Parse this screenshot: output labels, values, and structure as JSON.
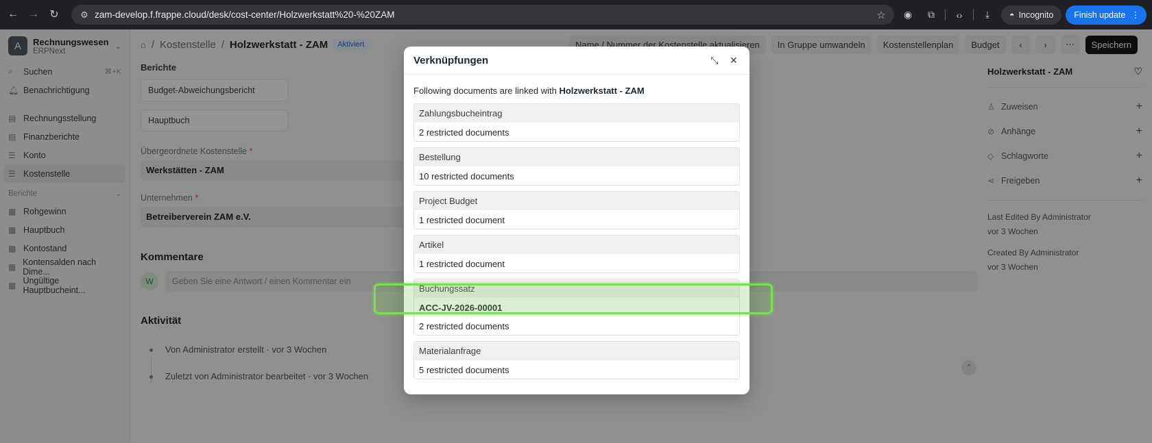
{
  "browser": {
    "url": "zam-develop.f.frappe.cloud/desk/cost-center/Holzwerkstatt%20-%20ZAM",
    "incognito_label": "Incognito",
    "update_label": "Finish update"
  },
  "sidebar": {
    "workspace_name": "Rechnungswesen",
    "workspace_app": "ERPNext",
    "workspace_initial": "A",
    "search_label": "Suchen",
    "search_shortcut": "⌘+K",
    "notification_label": "Benachrichtigung",
    "items": [
      {
        "label": "Rechnungsstellung"
      },
      {
        "label": "Finanzberichte"
      },
      {
        "label": "Konto"
      },
      {
        "label": "Kostenstelle"
      }
    ],
    "reports_section": "Berichte",
    "reports": [
      {
        "label": "Rohgewinn"
      },
      {
        "label": "Hauptbuch"
      },
      {
        "label": "Kontostand"
      },
      {
        "label": "Kontensalden nach Dime..."
      },
      {
        "label": "Ungültige Hauptbucheint..."
      }
    ]
  },
  "header": {
    "breadcrumb": "Kostenstelle",
    "title": "Holzwerkstatt - ZAM",
    "status": "Aktiviert",
    "actions": [
      "Name / Nummer der Kostenstelle aktualisieren",
      "In Gruppe umwandeln",
      "Kostenstellenplan",
      "Budget"
    ],
    "save_label": "Speichern"
  },
  "form": {
    "reports_title": "Berichte",
    "report_links": [
      "Budget-Abweichungsbericht",
      "Hauptbuch"
    ],
    "parent_label": "Übergeordnete Kostenstelle",
    "parent_value": "Werkstätten - ZAM",
    "company_label": "Unternehmen",
    "company_value": "Betreiberverein ZAM e.V.",
    "comments_title": "Kommentare",
    "comment_avatar": "W",
    "comment_placeholder": "Geben Sie eine Antwort / einen Kommentar ein",
    "activity_title": "Aktivität",
    "activity": [
      "Von Administrator erstellt · vor 3 Wochen",
      "Zuletzt von Administrator bearbeitet · vor 3 Wochen"
    ]
  },
  "right_panel": {
    "title": "Holzwerkstatt - ZAM",
    "rows": [
      {
        "label": "Zuweisen"
      },
      {
        "label": "Anhänge"
      },
      {
        "label": "Schlagworte"
      },
      {
        "label": "Freigeben"
      }
    ],
    "last_edited": "Last Edited By Administrator",
    "last_edited_when": "vor 3 Wochen",
    "created": "Created By Administrator",
    "created_when": "vor 3 Wochen"
  },
  "dialog": {
    "title": "Verknüpfungen",
    "intro_prefix": "Following documents are linked with ",
    "intro_doc": "Holzwerkstatt - ZAM",
    "links": [
      {
        "doctype": "Zahlungsbucheintrag",
        "rows": [
          "2 restricted documents"
        ]
      },
      {
        "doctype": "Bestellung",
        "rows": [
          "10 restricted documents"
        ]
      },
      {
        "doctype": "Project Budget",
        "rows": [
          "1 restricted document"
        ]
      },
      {
        "doctype": "Artikel",
        "rows": [
          "1 restricted document"
        ]
      },
      {
        "doctype": "Buchungssatz",
        "rows": [
          "ACC-JV-2026-00001",
          "2 restricted documents"
        ]
      },
      {
        "doctype": "Materialanfrage",
        "rows": [
          "5 restricted documents"
        ]
      }
    ]
  },
  "colors": {
    "highlight": "#7ed957",
    "primary_button": "#171717",
    "update_button": "#1a73e8"
  }
}
